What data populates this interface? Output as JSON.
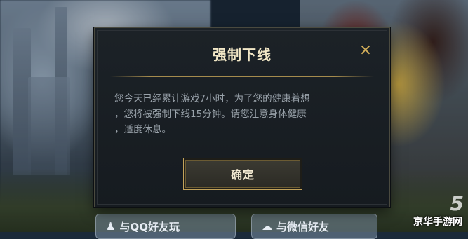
{
  "dialog": {
    "title": "强制下线",
    "close_icon": "×",
    "message_lines": [
      "您今天已经累计游戏7小时，为了您的健康着想",
      "，您将被强制下线15分钟。请您注意身体健康",
      "，适度休息。"
    ],
    "confirm_label": "确定"
  },
  "bottom_bar": {
    "qq_label": "与QQ好友玩",
    "wechat_label": "与微信好友"
  },
  "watermark": {
    "logo": "5",
    "text": "京华手游网"
  },
  "colors": {
    "dialog_bg": "#1a2025",
    "title": "#f2e7c6",
    "accent_gold": "#c3a35b",
    "message_text": "#9aa3ab"
  }
}
